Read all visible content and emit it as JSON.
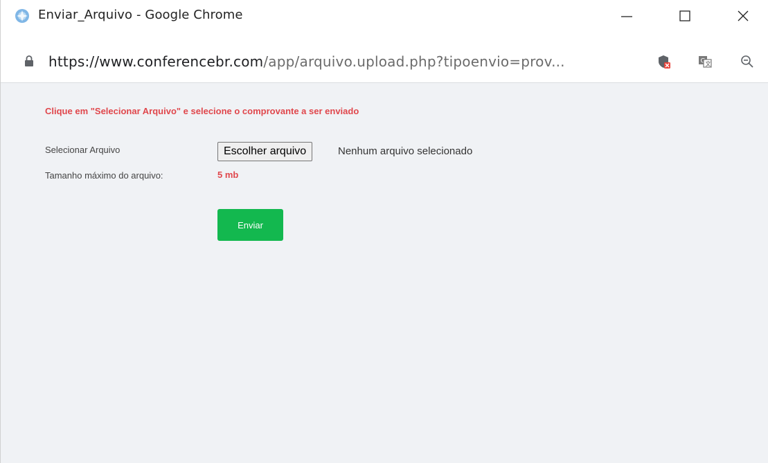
{
  "window": {
    "title": "Enviar_Arquivo - Google Chrome",
    "minimize_icon": "minimize-icon",
    "maximize_icon": "maximize-icon",
    "close_icon": "close-icon"
  },
  "addressbar": {
    "url_host": "https://www.conferencebr.com",
    "url_path": "/app/arquivo.upload.php?tipoenvio=prov...",
    "icons": [
      "lock-icon",
      "shield-blocked-icon",
      "translate-icon",
      "zoom-icon"
    ]
  },
  "page": {
    "instruction": "Clique em \"Selecionar Arquivo\" e selecione o comprovante a ser enviado",
    "file_label": "Selecionar Arquivo",
    "file_button": "Escolher arquivo",
    "file_status": "Nenhum arquivo selecionado",
    "size_label": "Tamanho máximo do arquivo:",
    "size_value": "5 mb",
    "submit_label": "Enviar"
  },
  "colors": {
    "accent_red": "#e0474c",
    "submit_green": "#13b84f",
    "content_bg": "#f0f2f5"
  }
}
